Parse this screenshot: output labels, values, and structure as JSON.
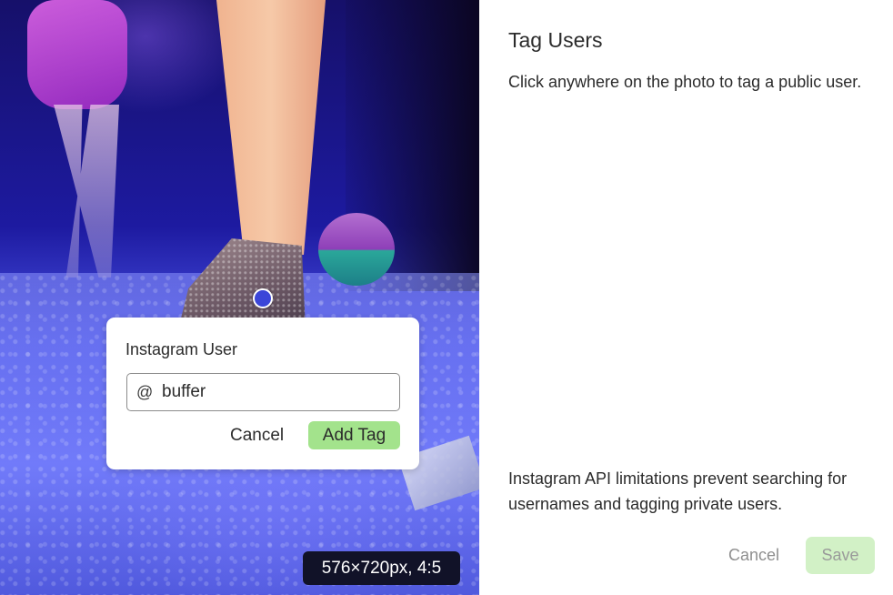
{
  "photo": {
    "dimensions_label": "576×720px, 4:5"
  },
  "tag_popover": {
    "title": "Instagram User",
    "at_symbol": "@",
    "input_value": "buffer",
    "cancel_label": "Cancel",
    "add_tag_label": "Add Tag"
  },
  "panel": {
    "heading": "Tag Users",
    "instruction": "Click anywhere on the photo to tag a public user.",
    "api_note": "Instagram API limitations prevent searching for usernames and tagging private users.",
    "cancel_label": "Cancel",
    "save_label": "Save"
  },
  "colors": {
    "accent_green": "#a3e38c",
    "save_disabled_bg": "#d2f1c6",
    "tag_dot": "#3b46d8",
    "badge_bg": "#111228"
  }
}
